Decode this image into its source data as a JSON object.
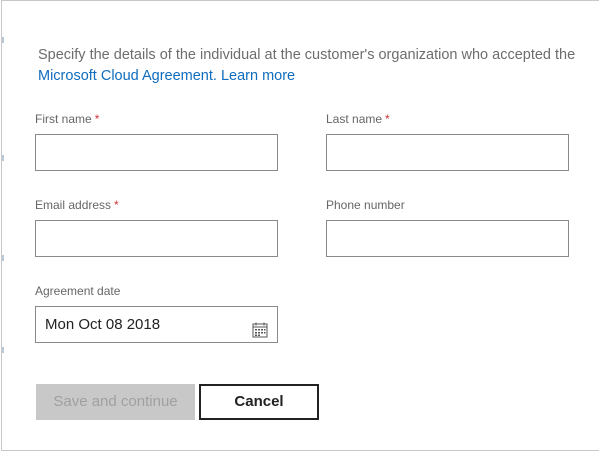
{
  "intro": {
    "text": "Specify the details of the individual at the customer's organization who accepted the ",
    "agreement_link": "Microsoft Cloud Agreement.",
    "learn_more_link": "Learn more"
  },
  "form": {
    "first_name": {
      "label": "First name",
      "required_mark": "*",
      "value": ""
    },
    "last_name": {
      "label": "Last name",
      "required_mark": "*",
      "value": ""
    },
    "email": {
      "label": "Email address",
      "required_mark": "*",
      "value": ""
    },
    "phone": {
      "label": "Phone number",
      "value": ""
    },
    "agreement_date": {
      "label": "Agreement date",
      "value": "Mon Oct 08 2018",
      "icon": "calendar-icon"
    }
  },
  "buttons": {
    "save_label": "Save and continue",
    "cancel_label": "Cancel"
  },
  "colors": {
    "link": "#0f6cbd",
    "required": "#d13438",
    "disabled_button_bg": "#c8c8c8"
  }
}
